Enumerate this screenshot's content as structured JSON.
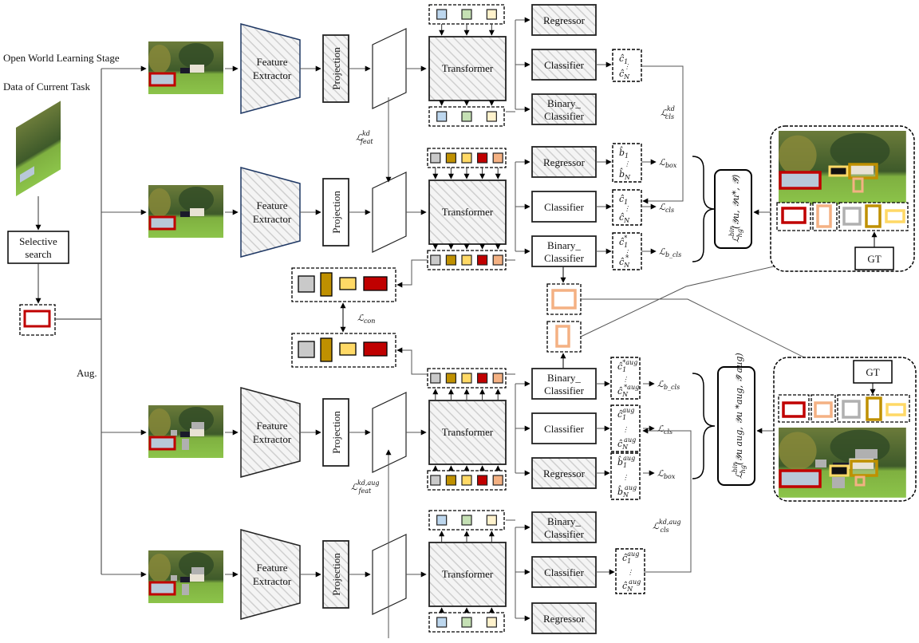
{
  "labels": {
    "stage": "Open World Learning Stage",
    "data": "Data of Current Task",
    "selective_search_1": "Selective",
    "selective_search_2": "search",
    "aug": "Aug.",
    "feature_extractor_1": "Feature",
    "feature_extractor_2": "Extractor",
    "projection": "Projection",
    "transformer": "Transformer",
    "regressor": "Regressor",
    "classifier": "Classifier",
    "binary_classifier_1": "Binary_",
    "binary_classifier_2": "Classifier",
    "gt": "GT"
  },
  "losses": {
    "feat_kd": "ℒ",
    "feat_kd_sup": "kd",
    "feat_kd_sub": "feat",
    "feat_kd_aug_sup": "kd,aug",
    "cls_kd_sup": "kd",
    "cls_kd_sub": "cls",
    "cls_kd_aug_sup": "kd,aug",
    "box": "ℒ",
    "box_sub": "box",
    "cls_sub": "cls",
    "b_cls_sub": "b_cls",
    "con_sub": "con",
    "hg_main": "ℒ",
    "hg_sup": "bin",
    "hg_sub": "hg",
    "hg_args": "(𝒴u, 𝒴u*, 𝒴̂)",
    "hg_aug_args": "(𝒴u aug, 𝒴u *aug, 𝒴̂ aug)"
  },
  "outputs": {
    "c1": "ĉ",
    "cN": "ĉ",
    "b1": "b̂",
    "idx1": "1",
    "idxN": "N",
    "star": "*",
    "aug": "aug",
    "staraug": "*aug",
    "dots": "⋮"
  },
  "colors": {
    "query_blue": "#bdd7ee",
    "query_green": "#c5e0b4",
    "query_cream": "#fff2cc",
    "obj_gray": "#c9c9c9",
    "obj_gold": "#bf9000",
    "obj_yellow": "#ffd966",
    "obj_red": "#c00000",
    "obj_peach": "#f4b183",
    "extractor_border": "#1f3864",
    "hatch": "#d0d0d0"
  }
}
